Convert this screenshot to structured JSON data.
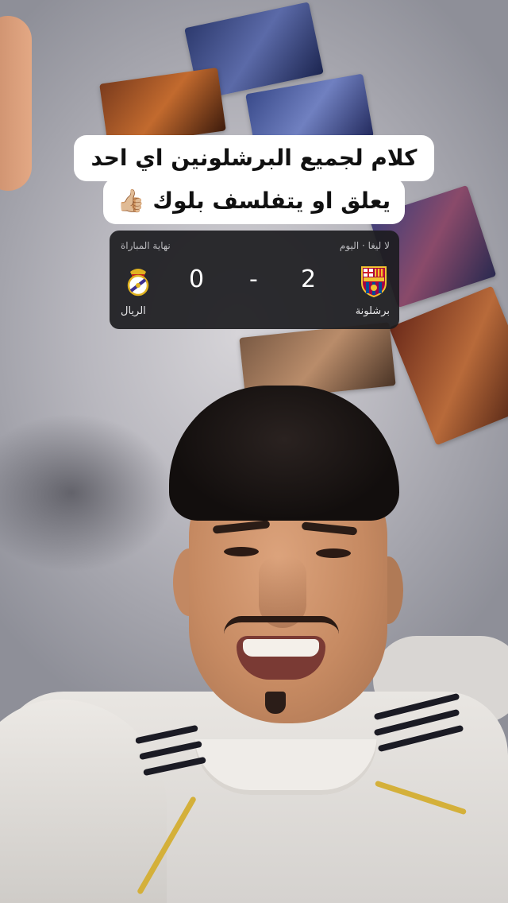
{
  "caption": {
    "line1": "كلام لجميع البرشلونين اي احد",
    "line2": "يعلق او يتفلسف بلوك",
    "emoji": "👍🏼"
  },
  "scoreboard": {
    "league_label": "لا ليغا · اليوم",
    "status_label": "نهاية المباراة",
    "home": {
      "name": "برشلونة",
      "score": "2",
      "crest": "barcelona-crest"
    },
    "away": {
      "name": "الريال",
      "score": "0",
      "crest": "real-madrid-crest"
    },
    "separator": "-"
  }
}
